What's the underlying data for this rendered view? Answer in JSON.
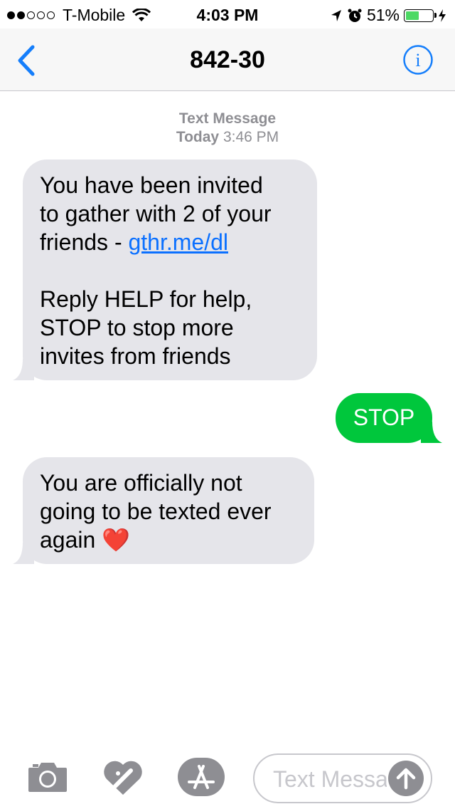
{
  "status_bar": {
    "carrier": "T-Mobile",
    "time": "4:03 PM",
    "battery_percent": "51%",
    "battery_level": 0.51,
    "signal_bars_filled": 2,
    "signal_bars_total": 5,
    "icons": [
      "wifi-icon",
      "location-arrow-icon",
      "alarm-clock-icon",
      "battery-icon",
      "charging-bolt-icon"
    ]
  },
  "nav": {
    "title": "842-30",
    "back_icon": "chevron-left-icon",
    "info_icon": "info-icon",
    "accent_color": "#157efb"
  },
  "conversation": {
    "timestamp_label": "Text Message",
    "timestamp_day": "Today",
    "timestamp_time": "3:46 PM",
    "messages": [
      {
        "direction": "incoming",
        "lines": [
          "You have been invited",
          "to gather with 2 of your"
        ],
        "link_prefix": "friends - ",
        "link_text": "gthr.me/dl",
        "lines_after": [
          "Reply HELP for help,",
          "STOP to stop more",
          "invites from friends"
        ]
      },
      {
        "direction": "outgoing",
        "text": "STOP"
      },
      {
        "direction": "incoming",
        "lines": [
          "You are officially not",
          "going to be texted ever"
        ],
        "last_line": "again",
        "emoji": "❤️"
      }
    ],
    "incoming_color": "#e5e5ea",
    "outgoing_color": "#00c73c"
  },
  "input_bar": {
    "placeholder": "Text Message",
    "icons": [
      "camera-icon",
      "digital-touch-icon",
      "app-store-icon",
      "send-arrow-icon"
    ]
  }
}
